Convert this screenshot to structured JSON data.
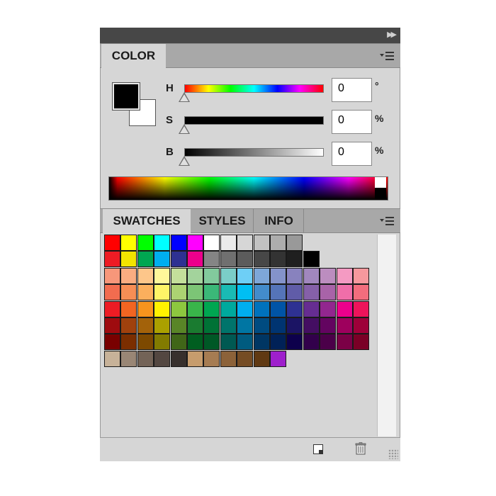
{
  "color_panel": {
    "tab_label": "COLOR",
    "foreground_color": "#000000",
    "background_color": "#ffffff",
    "channels": [
      {
        "label": "H",
        "value": "0",
        "unit": "°"
      },
      {
        "label": "S",
        "value": "0",
        "unit": "%"
      },
      {
        "label": "B",
        "value": "0",
        "unit": "%"
      }
    ]
  },
  "swatches_panel": {
    "tabs": [
      {
        "label": "SWATCHES",
        "active": true
      },
      {
        "label": "STYLES",
        "active": false
      },
      {
        "label": "INFO",
        "active": false
      }
    ],
    "rows": [
      [
        "#ff0000",
        "#ffff00",
        "#00ff00",
        "#00ffff",
        "#0000ff",
        "#ff00ff",
        "#ffffff",
        "#ebebeb",
        "#d6d6d6",
        "#c2c2c2",
        "#adadad",
        "#999999"
      ],
      [
        "#ee1c24",
        "#f2e400",
        "#00a651",
        "#00aeef",
        "#2e3192",
        "#ec008c",
        "#858585",
        "#707070",
        "#5c5c5c",
        "#474747",
        "#333333",
        "#1f1f1f",
        "#000000"
      ],
      [
        "#f7977a",
        "#f9ad81",
        "#fdc68a",
        "#fff79a",
        "#c4df9b",
        "#a3d39c",
        "#82ca9d",
        "#7bcdc8",
        "#6ecff6",
        "#7ea7d8",
        "#8493ca",
        "#8882be",
        "#a187be",
        "#bc8dbf",
        "#f49ac2",
        "#f6989d"
      ],
      [
        "#f26c4f",
        "#f68e55",
        "#fbaf5d",
        "#fff467",
        "#acd372",
        "#7cc576",
        "#3bb878",
        "#1abbb4",
        "#00bff3",
        "#438ccb",
        "#5574b9",
        "#605ca8",
        "#8560a8",
        "#a863a8",
        "#f06ea9",
        "#f26d7d"
      ],
      [
        "#ed1c24",
        "#f26522",
        "#f7941d",
        "#fff200",
        "#8dc73f",
        "#39b54a",
        "#00a651",
        "#00a99d",
        "#00aeef",
        "#0072bc",
        "#0054a6",
        "#2e3192",
        "#662d91",
        "#92278f",
        "#ec008c",
        "#ed145b"
      ],
      [
        "#9e0b0f",
        "#a0410d",
        "#a3620a",
        "#aba000",
        "#598527",
        "#1a7b30",
        "#007236",
        "#00746b",
        "#0076a3",
        "#004b80",
        "#003471",
        "#1b1464",
        "#440e62",
        "#630460",
        "#9e005d",
        "#9e0039"
      ],
      [
        "#790000",
        "#7b2e00",
        "#7d4900",
        "#827b00",
        "#406618",
        "#005e20",
        "#005826",
        "#005952",
        "#005b7f",
        "#003663",
        "#002157",
        "#0d004c",
        "#32004b",
        "#4b0049",
        "#7b0046",
        "#7a0026"
      ],
      [
        "#c7b299",
        "#998675",
        "#736357",
        "#534741",
        "#37302d",
        "#c69c6d",
        "#a67c52",
        "#8c6239",
        "#754c24",
        "#603913",
        "#9e1fcc"
      ]
    ]
  }
}
